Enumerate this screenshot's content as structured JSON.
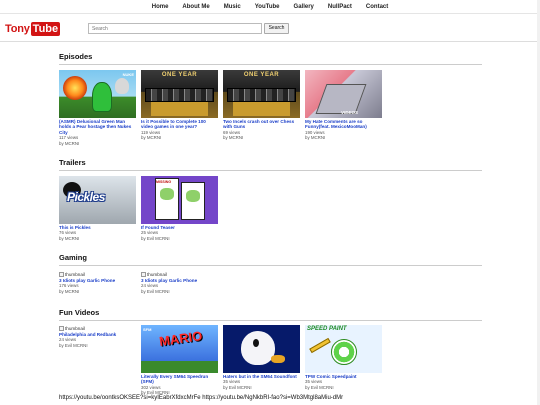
{
  "nav": {
    "items": [
      "Home",
      "About Me",
      "Music",
      "YouTube",
      "Gallery",
      "NullPact",
      "Contact"
    ]
  },
  "logo": {
    "part1": "Tony",
    "part2": "Tube"
  },
  "search": {
    "placeholder": "Search",
    "button_label": "Search"
  },
  "sections": {
    "episodes": {
      "heading": "Episodes",
      "items": [
        {
          "title": "(ASMR) Delusional Green Man holds a Pear hostage then Nukes City",
          "views": "117 views",
          "author": "by MCRNI",
          "thumb_icon": "green-man-thumbnail"
        },
        {
          "title": "Is it Possible to Complete 100 video games in one year?",
          "views": "119 views",
          "author": "by MCRNI",
          "thumb_icon": "games-thumbnail"
        },
        {
          "title": "Two Incels crash out over Chess with Guns",
          "views": "69 views",
          "author": "by MCRNI",
          "thumb_icon": "games-thumbnail"
        },
        {
          "title": "My Hate Comments are so Funny(feat. MexicoMooMan)",
          "views": "190 views",
          "author": "by MCRNI",
          "thumb_icon": "ramp-thumbnail"
        }
      ]
    },
    "trailers": {
      "heading": "Trailers",
      "items": [
        {
          "title": "This is Pickles",
          "views": "76 views",
          "author": "by MCRNI",
          "thumb_icon": "pickles-thumbnail"
        },
        {
          "title": "If Found Teaser",
          "views": "25 views",
          "author": "by Evil MCRNI",
          "thumb_icon": "missing-poster-thumbnail"
        }
      ]
    },
    "gaming": {
      "heading": "Gaming",
      "items": [
        {
          "thumb_alt": "thumbnail",
          "title": "3 Idiots play Garlic Phone",
          "views": "176 views",
          "author": "by MCRNI"
        },
        {
          "thumb_alt": "thumbnail",
          "title": "3 Idiots play Garlic Phone",
          "views": "24 views",
          "author": "by Evil MCRNI"
        }
      ]
    },
    "fun_videos": {
      "heading": "Fun Videos",
      "items": [
        {
          "thumb_alt": "thumbnail",
          "title": "Philadelphia and Redbank",
          "views": "24 views",
          "author": "by Evil MCRNI"
        },
        {
          "title": "Literally Every SM64 Speedrun (SFM)",
          "views": "302 views",
          "author": "by Evil MCRNI",
          "thumb_icon": "mario-thumbnail"
        },
        {
          "title": "Haters but in the SM64 Soundfont",
          "views": "35 views",
          "author": "by Evil MCRNI",
          "thumb_icon": "boo-thumbnail"
        },
        {
          "title": "TPW Comic Speedpaint",
          "views": "35 views",
          "author": "by Evil MCRNI",
          "thumb_icon": "speedpaint-thumbnail"
        }
      ]
    }
  },
  "footer": {
    "urls": "https://youtu.be/oontksOKSEE?si=kyIEabrXfdxcMrFe https://youtu.be/NgNkbRI-fao?si=Wb3Mtgl8aMiu-dMr"
  }
}
